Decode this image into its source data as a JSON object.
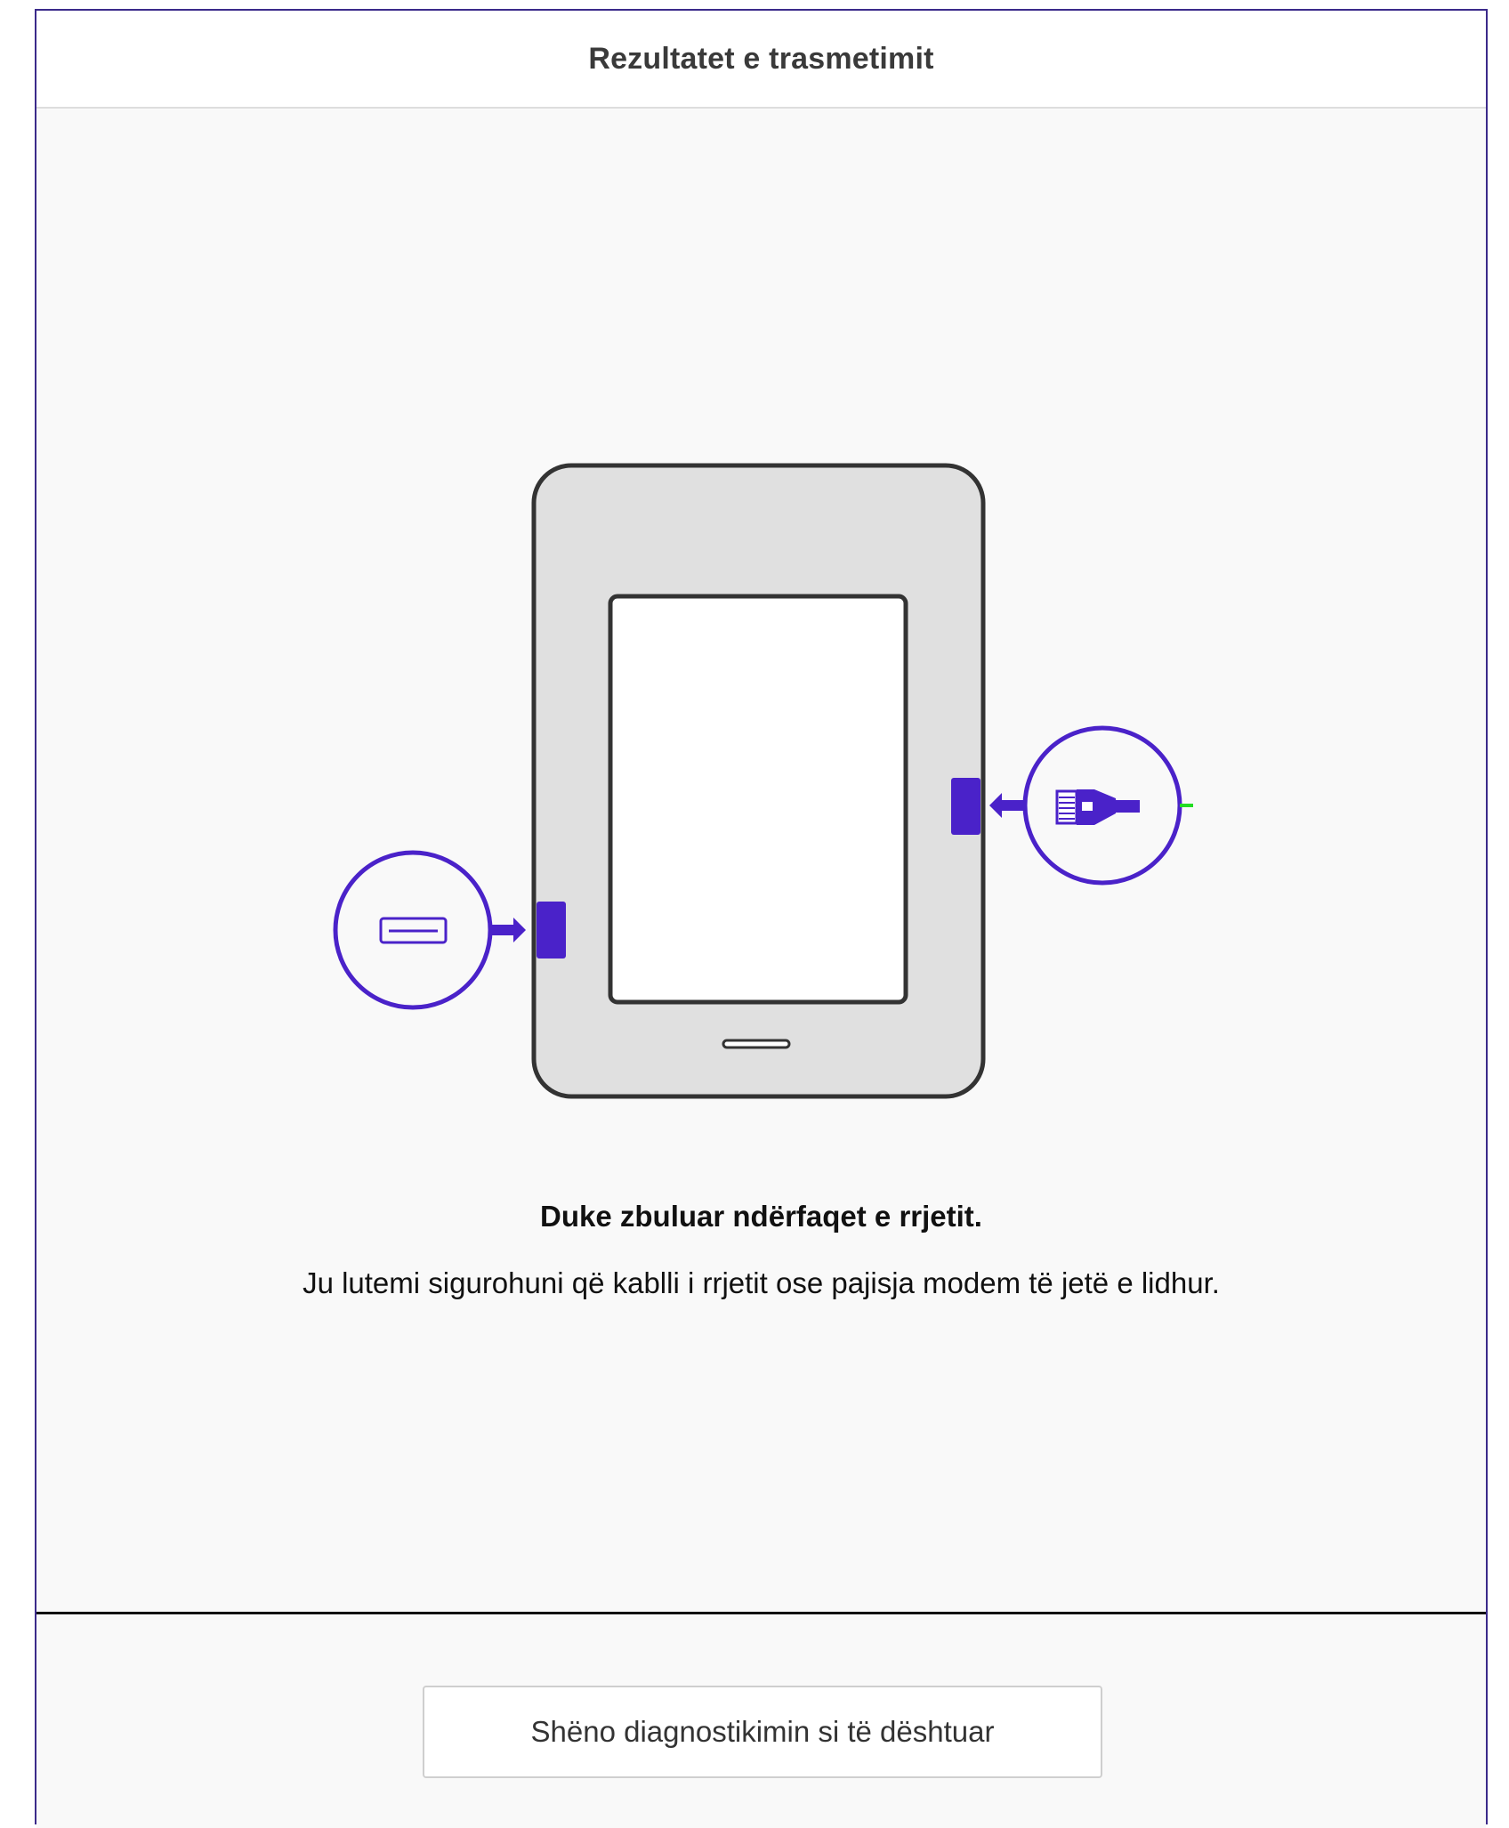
{
  "header": {
    "title": "Rezultatet e trasmetimit"
  },
  "status": {
    "heading": "Duke zbuluar ndërfaqet e rrjetit.",
    "message": "Ju lutemi sigurohuni që kablli i rrjetit ose pajisja modem të jetë e lidhur."
  },
  "footer": {
    "fail_button_label": "Shëno diagnostikimin si të dështuar"
  },
  "illustration": {
    "device": "tablet-icon",
    "left_port": "usb-port-icon",
    "right_port": "ethernet-cable-icon"
  },
  "colors": {
    "accent": "#4a22c9",
    "device_fill": "#e0e0e0",
    "device_outline": "#333333",
    "screen_fill": "#ffffff",
    "cable_tip": "#22dd22"
  }
}
